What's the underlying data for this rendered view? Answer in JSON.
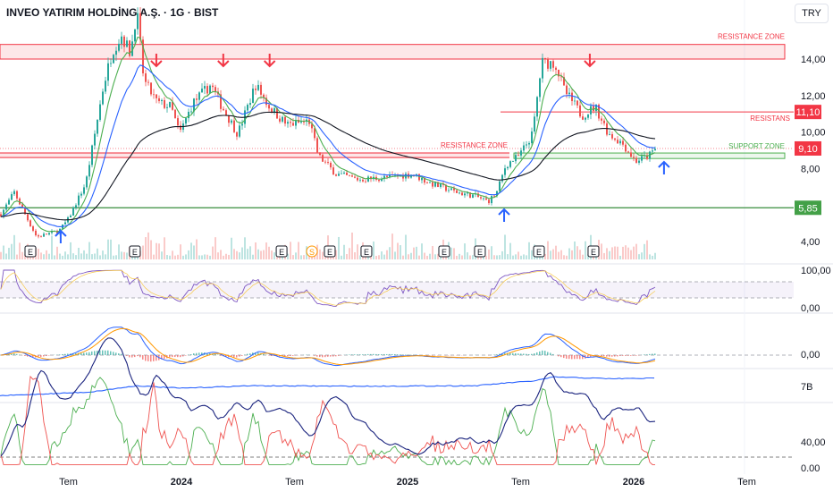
{
  "header": {
    "title": "INVEO YATIRIM HOLDİNG A.Ş. · 1G · BIST",
    "currency": "TRY"
  },
  "colors": {
    "up": "#26a69a",
    "down": "#ef5350",
    "ma_short": "#4caf50",
    "ma_mid": "#2962ff",
    "ma_long": "#131722",
    "resistance": "#f23645",
    "support": "#4caf50",
    "rsi": "#7e57c2",
    "signal": "#ff9800"
  },
  "chart_data": {
    "type": "line",
    "title": "INVEO YATIRIM HOLDİNG A.Ş. · 1G · BIST",
    "x_unit": "year",
    "price": {
      "x": [
        2023.198,
        2023.257,
        2023.316,
        2023.356,
        2023.455,
        2023.494,
        2023.573,
        2023.613,
        2023.652,
        2023.692,
        2023.731,
        2023.771,
        2023.798,
        2023.83,
        2023.889,
        2023.949,
        2023.988,
        2024.047,
        2024.126,
        2024.166,
        2024.245,
        2024.324,
        2024.383,
        2024.462,
        2024.561,
        2024.601,
        2024.68,
        2024.779,
        2024.897,
        2025.016,
        2025.095,
        2025.213,
        2025.292,
        2025.352,
        2025.391,
        2025.431,
        2025.49,
        2025.549,
        2025.589,
        2025.648,
        2025.688,
        2025.767,
        2025.826,
        2025.885,
        2025.945,
        2026.004,
        2026.063,
        2026.095
      ],
      "y": [
        5.5,
        6.7,
        5.2,
        4.25,
        4.6,
        5.2,
        7.2,
        9.9,
        12.6,
        14.5,
        15.3,
        14.3,
        16.7,
        12.8,
        11.6,
        11.4,
        9.9,
        11.6,
        12.6,
        11.6,
        9.9,
        12.6,
        11.4,
        10.4,
        10.6,
        8.7,
        7.7,
        7.4,
        7.5,
        7.7,
        7.2,
        6.7,
        6.5,
        6.2,
        6.7,
        8.2,
        8.7,
        9.9,
        13.8,
        13.8,
        12.3,
        10.9,
        11.4,
        9.9,
        9.4,
        8.4,
        8.7,
        9.1
      ]
    },
    "price_axis": {
      "ticks": [
        "14,00",
        "12,00",
        "10,00",
        "8,00",
        "4,00"
      ],
      "tick_values": [
        14,
        12,
        10,
        8,
        4
      ]
    },
    "time_axis": {
      "labels": [
        "Tem",
        "2024",
        "Tem",
        "2025",
        "Tem",
        "2026",
        "Tem"
      ],
      "values": [
        2023.5,
        2024.0,
        2024.5,
        2025.0,
        2025.5,
        2026.0,
        2026.5
      ],
      "bold": [
        false,
        true,
        false,
        true,
        false,
        true,
        false
      ]
    },
    "levels": [
      {
        "label": "RESISTANCE ZONE",
        "type": "zone",
        "from": 14.0,
        "to": 14.8
      },
      {
        "label": "RESISTANS",
        "type": "line",
        "value": 11.1,
        "tag": "11,10"
      },
      {
        "label": "",
        "type": "dotted",
        "value": 9.1,
        "tag": "9,10"
      },
      {
        "label": "RESISTANCE ZONE",
        "type": "zone_left",
        "from": 8.6,
        "to": 8.85
      },
      {
        "label": "SUPPORT ZONE",
        "type": "support_zone",
        "from": 8.55,
        "to": 8.85
      },
      {
        "label": "",
        "type": "line",
        "value": 5.85,
        "tag": "5,85"
      }
    ],
    "signals": {
      "sell_arrows": [
        2023.889,
        2024.185,
        2024.39,
        2025.806
      ],
      "buy_arrows": [
        2023.466,
        2025.427,
        2026.134
      ]
    },
    "events": [
      {
        "label": "E",
        "x": 2023.332
      },
      {
        "label": "E",
        "x": 2023.794
      },
      {
        "label": "E",
        "x": 2024.443
      },
      {
        "label": "S",
        "x": 2024.577
      },
      {
        "label": "E",
        "x": 2024.656
      },
      {
        "label": "E",
        "x": 2024.818
      },
      {
        "label": "E",
        "x": 2025.162
      },
      {
        "label": "E",
        "x": 2025.32
      },
      {
        "label": "E",
        "x": 2025.581
      },
      {
        "label": "E",
        "x": 2025.822
      }
    ],
    "rsi_panel": {
      "ticks": [
        "100,00",
        "0,00"
      ],
      "ylim": [
        0,
        100
      ]
    },
    "macd_panel": {
      "ticks": [
        "0,00"
      ]
    },
    "obv_panel": {
      "ticks": [
        "7B"
      ],
      "x": [
        2023.198,
        2023.6,
        2023.8,
        2024.0,
        2024.3,
        2024.8,
        2025.3,
        2025.45,
        2025.55,
        2025.65,
        2025.9,
        2026.1
      ],
      "y": [
        0.2,
        0.35,
        0.6,
        0.5,
        0.6,
        0.58,
        0.6,
        0.72,
        0.78,
        0.95,
        0.88,
        0.9
      ]
    },
    "dmi_panel": {
      "ticks": [
        "40,00",
        "0.00"
      ],
      "ylim": [
        0,
        50
      ]
    }
  }
}
